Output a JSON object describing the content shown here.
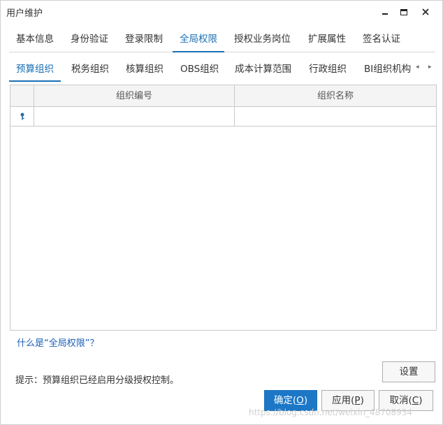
{
  "window": {
    "title": "用户维护"
  },
  "tabs_primary": [
    {
      "label": "基本信息",
      "active": false
    },
    {
      "label": "身份验证",
      "active": false
    },
    {
      "label": "登录限制",
      "active": false
    },
    {
      "label": "全局权限",
      "active": true
    },
    {
      "label": "授权业务岗位",
      "active": false
    },
    {
      "label": "扩展属性",
      "active": false
    },
    {
      "label": "签名认证",
      "active": false
    }
  ],
  "tabs_secondary": [
    {
      "label": "预算组织",
      "active": true
    },
    {
      "label": "税务组织",
      "active": false
    },
    {
      "label": "核算组织",
      "active": false
    },
    {
      "label": "OBS组织",
      "active": false
    },
    {
      "label": "成本计算范围",
      "active": false
    },
    {
      "label": "行政组织",
      "active": false
    },
    {
      "label": "BI组织机构",
      "active": false
    }
  ],
  "grid": {
    "columns": [
      "组织编号",
      "组织名称"
    ],
    "rows": [
      {
        "code": "",
        "name": ""
      }
    ]
  },
  "help_link": "什么是“全局权限”？",
  "hint": "提示：预算组织已经启用分级授权控制。",
  "buttons": {
    "settings": "设置",
    "ok": "确定(",
    "ok_key": "O",
    "ok_end": ")",
    "apply": "应用(",
    "apply_key": "P",
    "apply_end": ")",
    "cancel": "取消(",
    "cancel_key": "C",
    "cancel_end": ")"
  },
  "watermark": "https://blog.csdn.net/weixin_48708934",
  "colors": {
    "accent": "#1c6fb5",
    "primary_button": "#1c78c7",
    "link": "#1c5fb5"
  }
}
